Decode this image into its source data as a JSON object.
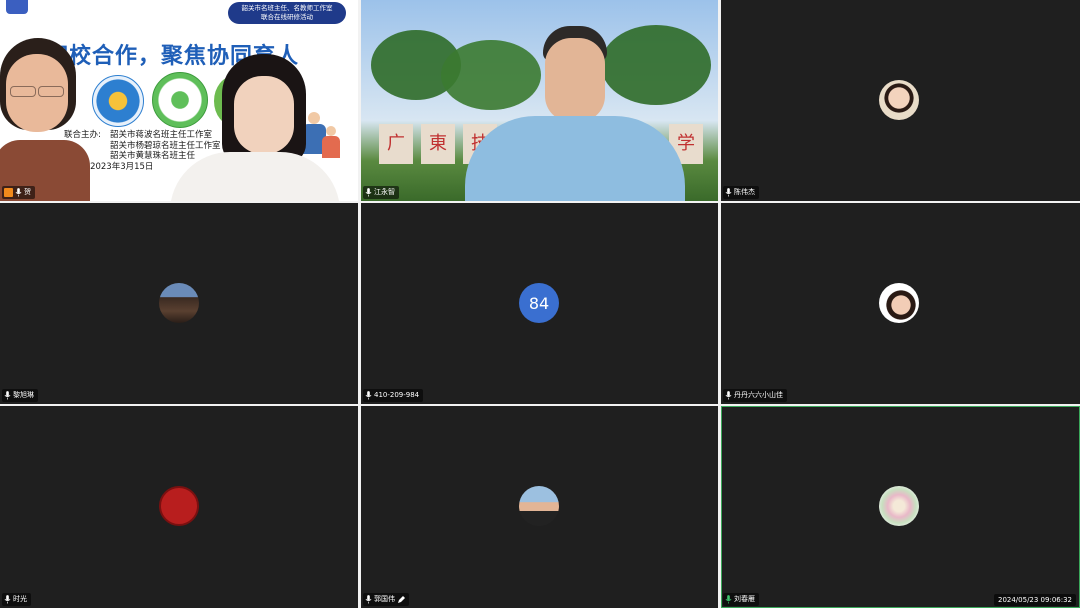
{
  "meeting": {
    "timestamp": "2024/05/23 09:06:32"
  },
  "presenter_slide": {
    "title": "家校合作，聚焦协同育人",
    "badge_line1": "韶关市名班主任、名教师工作室",
    "badge_line2": "联合在线研修活动",
    "organizer_label": "联合主办:",
    "organizer_1": "韶关市蒋波名班主任工作室",
    "organizer_2": "韶关市杨碧琼名班主任工作室",
    "organizer_3": "韶关市黄慧珠名班主任",
    "time_label": "间:",
    "time_value": "2023年3月15日"
  },
  "tiles": [
    {
      "name": "贺",
      "type": "video"
    },
    {
      "name": "江永智",
      "type": "video"
    },
    {
      "name": "陈伟杰",
      "type": "avatar"
    },
    {
      "name": "黎旭琳",
      "type": "avatar"
    },
    {
      "name": "410-209-984",
      "type": "number",
      "number": "84"
    },
    {
      "name": "丹丹六六小山佳",
      "type": "avatar"
    },
    {
      "name": "时光",
      "type": "avatar"
    },
    {
      "name": "郭国伟",
      "type": "avatar"
    },
    {
      "name": "刘春雁",
      "type": "avatar"
    }
  ],
  "icons": {
    "microphone": "microphone-icon",
    "host": "host-icon",
    "edit": "pencil-icon"
  },
  "colors": {
    "tile_bg": "#1f1f1f",
    "active_border": "#3aa85a",
    "number_avatar": "#3a6fd0",
    "slide_title": "#1f5fb8"
  }
}
